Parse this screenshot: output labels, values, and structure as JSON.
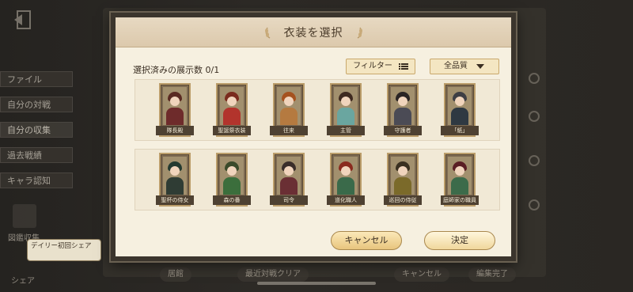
{
  "background": {
    "menu": [
      "ファイル",
      "自分の対戦",
      "自分の収集",
      "過去戦績",
      "キャラ認知"
    ],
    "active_menu_index": 2,
    "collection_label": "図鑑収集",
    "daily_bubble": "デイリー初回シェア",
    "share_label": "シェア",
    "bottom_buttons": [
      "居館",
      "最近対戦クリア",
      "キャンセル",
      "編集完了"
    ]
  },
  "modal": {
    "title": "衣装を選択",
    "selected_count": "選択済みの展示数 0/1",
    "filter_label": "フィルター",
    "filter_icon": "list-icon",
    "quality_label": "全品質",
    "quality_icon": "chevron-down-icon",
    "cancel_label": "キャンセル",
    "confirm_label": "決定",
    "cards": [
      [
        {
          "name": "隊長殿",
          "hair": "#5a2a22",
          "body": "#6e2b2b"
        },
        {
          "name": "聖誕祭衣装",
          "hair": "#7a2b1e",
          "body": "#b2342c"
        },
        {
          "name": "往来",
          "hair": "#a5521f",
          "body": "#b57a40"
        },
        {
          "name": "主管",
          "hair": "#3f2a20",
          "body": "#6aa6a0"
        },
        {
          "name": "守護者",
          "hair": "#2a2424",
          "body": "#4b4b55"
        },
        {
          "name": "「紙」",
          "hair": "#3e3e44",
          "body": "#2f3942"
        }
      ],
      [
        {
          "name": "聖杯の侍女",
          "hair": "#243a30",
          "body": "#2f3c34"
        },
        {
          "name": "森の番",
          "hair": "#3a4a2a",
          "body": "#3b6e3c"
        },
        {
          "name": "司令",
          "hair": "#3a2e2a",
          "body": "#6a2f34"
        },
        {
          "name": "道化職人",
          "hair": "#8a2a1e",
          "body": "#3a6a4a"
        },
        {
          "name": "巡回の侍従",
          "hair": "#3a3020",
          "body": "#7b6a2a"
        },
        {
          "name": "庭師家の職員",
          "hair": "#5a1e24",
          "body": "#3c6b4a"
        }
      ]
    ]
  }
}
